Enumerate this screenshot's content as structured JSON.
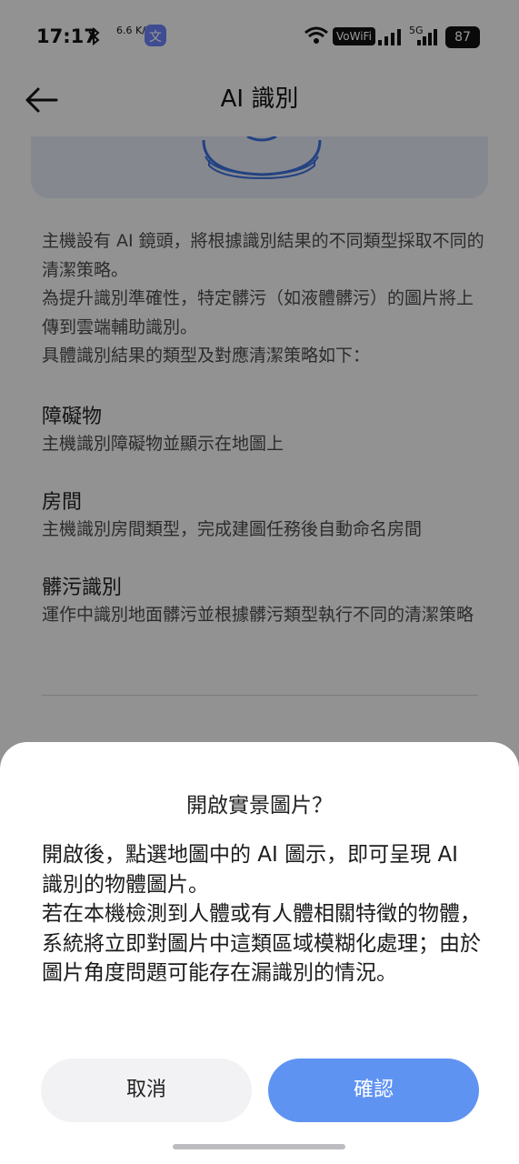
{
  "status_bar": {
    "time": "17:17",
    "speed": "6.6 K/s",
    "wifi_badge": "VoWiFi",
    "network": "5G",
    "battery": "87",
    "icons": [
      "bluetooth-icon",
      "translate-app-icon",
      "wifi-icon",
      "signal-icon",
      "battery-icon"
    ]
  },
  "header": {
    "title": "AI 識別",
    "back_icon": "arrow-left-icon"
  },
  "intro": {
    "lines": [
      "主機設有 AI 鏡頭，將根據識別結果的不同類型採取不同的清潔策略。",
      "為提升識別準確性，特定髒污（如液體髒污）的圖片將上傳到雲端輔助識別。",
      "具體識別結果的類型及對應清潔策略如下："
    ]
  },
  "sections": [
    {
      "title": "障礙物",
      "desc": "主機識別障礙物並顯示在地圖上"
    },
    {
      "title": "房間",
      "desc": "主機識別房間類型，完成建圖任務後自動命名房間"
    },
    {
      "title": "髒污識別",
      "desc": "運作中識別地面髒污並根據髒污類型執行不同的清潔策略"
    }
  ],
  "dialog": {
    "title": "開啟實景圖片？",
    "body": [
      "開啟後，點選地圖中的 AI 圖示，即可呈現 AI 識別的物體圖片。",
      "若在本機檢測到人體或有人體相關特徵的物體，系統將立即對圖片中這類區域模糊化處理；由於圖片角度問題可能存在漏識別的情況。"
    ],
    "cancel_label": "取消",
    "confirm_label": "確認"
  },
  "colors": {
    "accent": "#5f93f2",
    "scrim": "rgba(0,0,0,0.40)",
    "sheet": "#ffffff",
    "hero_card": "#dfe3f1"
  }
}
